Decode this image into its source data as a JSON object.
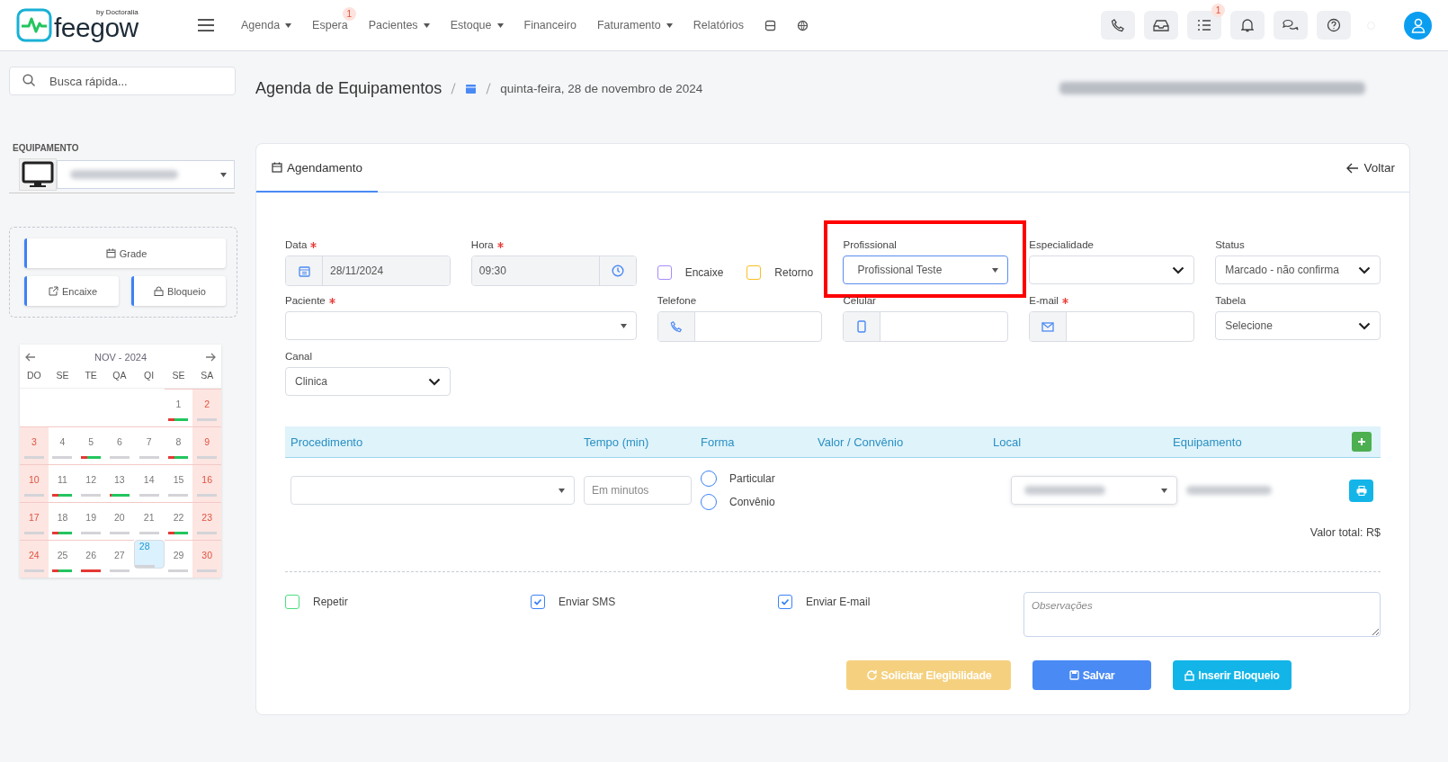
{
  "header": {
    "logo_text": "feegow",
    "logo_byline": "by Doctoralia",
    "nav": [
      {
        "label": "Agenda",
        "dropdown": true
      },
      {
        "label": "Espera",
        "dropdown": false,
        "badge": "1"
      },
      {
        "label": "Pacientes",
        "dropdown": true
      },
      {
        "label": "Estoque",
        "dropdown": true
      },
      {
        "label": "Financeiro",
        "dropdown": false
      },
      {
        "label": "Faturamento",
        "dropdown": true
      },
      {
        "label": "Relatórios",
        "dropdown": false
      }
    ],
    "tools": [
      {
        "kind": "phone"
      },
      {
        "kind": "inbox"
      },
      {
        "kind": "list",
        "badge": "1"
      },
      {
        "kind": "bell"
      },
      {
        "kind": "chat"
      },
      {
        "kind": "help"
      }
    ]
  },
  "search": {
    "placeholder": "Busca rápida..."
  },
  "breadcrumb": {
    "title": "Agenda de Equipamentos",
    "date": "quinta-feira, 28 de novembro de 2024"
  },
  "sidebar": {
    "equipment_label": "EQUIPAMENTO",
    "buttons": [
      {
        "kind": "grid",
        "label": "Grade"
      },
      {
        "kind": "fit",
        "label": "Encaixe"
      },
      {
        "kind": "lock",
        "label": "Bloqueio"
      }
    ],
    "calendar": {
      "title": "NOV - 2024",
      "weekdays": [
        "DO",
        "SE",
        "TE",
        "QA",
        "QI",
        "SE",
        "SA"
      ],
      "weeks": [
        [
          {
            "kind": "blank"
          },
          {
            "kind": "blank"
          },
          {
            "kind": "blank"
          },
          {
            "kind": "blank"
          },
          {
            "kind": "blank"
          },
          {
            "kind": "mixed",
            "day": "1",
            "weekend": false,
            "selected": false
          },
          {
            "kind": "free",
            "day": "2",
            "weekend": true,
            "selected": false
          }
        ],
        [
          {
            "kind": "free",
            "day": "3",
            "weekend": true,
            "selected": false
          },
          {
            "kind": "free",
            "day": "4",
            "weekend": false,
            "selected": false
          },
          {
            "kind": "mixed",
            "day": "5",
            "weekend": false,
            "selected": false
          },
          {
            "kind": "free",
            "day": "6",
            "weekend": false,
            "selected": false
          },
          {
            "kind": "free",
            "day": "7",
            "weekend": false,
            "selected": false
          },
          {
            "kind": "mixed",
            "day": "8",
            "weekend": false,
            "selected": false
          },
          {
            "kind": "free",
            "day": "9",
            "weekend": true,
            "selected": false
          }
        ],
        [
          {
            "kind": "free",
            "day": "10",
            "weekend": true,
            "selected": false
          },
          {
            "kind": "mixed",
            "day": "11",
            "weekend": false,
            "selected": false
          },
          {
            "kind": "free",
            "day": "12",
            "weekend": false,
            "selected": false
          },
          {
            "kind": "booked",
            "day": "13",
            "weekend": false,
            "selected": false
          },
          {
            "kind": "free",
            "day": "14",
            "weekend": false,
            "selected": false
          },
          {
            "kind": "free",
            "day": "15",
            "weekend": false,
            "selected": false
          },
          {
            "kind": "free",
            "day": "16",
            "weekend": true,
            "selected": false
          }
        ],
        [
          {
            "kind": "free",
            "day": "17",
            "weekend": true,
            "selected": false
          },
          {
            "kind": "mixed",
            "day": "18",
            "weekend": false,
            "selected": false
          },
          {
            "kind": "free",
            "day": "19",
            "weekend": false,
            "selected": false
          },
          {
            "kind": "free",
            "day": "20",
            "weekend": false,
            "selected": false
          },
          {
            "kind": "free",
            "day": "21",
            "weekend": false,
            "selected": false
          },
          {
            "kind": "mixed",
            "day": "22",
            "weekend": false,
            "selected": false
          },
          {
            "kind": "free",
            "day": "23",
            "weekend": true,
            "selected": false
          }
        ],
        [
          {
            "kind": "free",
            "day": "24",
            "weekend": true,
            "selected": false
          },
          {
            "kind": "mixed",
            "day": "25",
            "weekend": false,
            "selected": false
          },
          {
            "kind": "cancelled",
            "day": "26",
            "weekend": false,
            "selected": false
          },
          {
            "kind": "free",
            "day": "27",
            "weekend": false,
            "selected": false
          },
          {
            "kind": "free",
            "day": "28",
            "weekend": false,
            "selected": true
          },
          {
            "kind": "free",
            "day": "29",
            "weekend": false,
            "selected": false
          },
          {
            "kind": "free",
            "day": "30",
            "weekend": true,
            "selected": false
          }
        ]
      ]
    }
  },
  "form": {
    "tab": "Agendamento",
    "back": "Voltar",
    "data": {
      "label": "Data",
      "required": true,
      "value": "28/11/2024"
    },
    "hora": {
      "label": "Hora",
      "required": true,
      "value": "09:30"
    },
    "flags": [
      {
        "label": "Encaixe",
        "checked": false,
        "color": "#a78bfa"
      },
      {
        "label": "Retorno",
        "checked": false,
        "color": "#fbbf24"
      }
    ],
    "profissional": {
      "label": "Profissional",
      "value": "Profissional Teste",
      "highlighted": true
    },
    "especialidade": {
      "label": "Especialidade"
    },
    "status": {
      "label": "Status",
      "value": "Marcado - não confirma"
    },
    "paciente": {
      "label": "Paciente",
      "required": true
    },
    "contacts": [
      {
        "kind": "phone",
        "label": "Telefone",
        "required": false
      },
      {
        "kind": "mobile",
        "label": "Celular",
        "required": false
      },
      {
        "kind": "mail",
        "label": "E-mail",
        "required": true
      }
    ],
    "tabela": {
      "label": "Tabela",
      "value": "Selecione"
    },
    "canal": {
      "label": "Canal",
      "value": "Clinica"
    }
  },
  "procedures": {
    "columns": [
      "Procedimento",
      "Tempo (min)",
      "Forma",
      "Valor / Convênio",
      "Local",
      "Equipamento"
    ],
    "tempo_placeholder": "Em minutos",
    "forma": [
      {
        "label": "Particular",
        "selected": false
      },
      {
        "label": "Convênio",
        "selected": false
      }
    ],
    "total": "Valor total: R$"
  },
  "options": [
    {
      "label": "Repetir",
      "checked": false,
      "color": "#4ade80"
    },
    {
      "label": "Enviar SMS",
      "checked": true,
      "color": "#3b82f6"
    },
    {
      "label": "Enviar E-mail",
      "checked": true,
      "color": "#3b82f6"
    }
  ],
  "notes": {
    "placeholder": "Observações"
  },
  "actions": [
    {
      "kind": "eligibility",
      "label": "Solicitar Elegibilidade",
      "disabled": true
    },
    {
      "kind": "save",
      "label": "Salvar",
      "disabled": false
    },
    {
      "kind": "block",
      "label": "Inserir Bloqueio",
      "disabled": false
    }
  ]
}
